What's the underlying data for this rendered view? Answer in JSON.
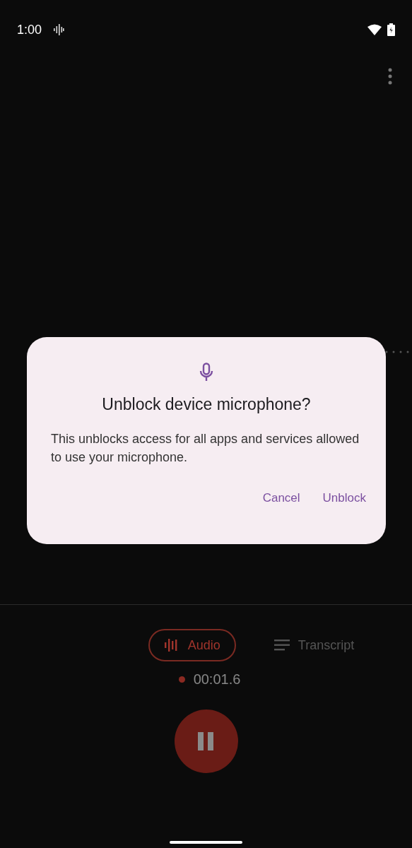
{
  "status_bar": {
    "time": "1:00"
  },
  "dialog": {
    "title": "Unblock device microphone?",
    "message": "This unblocks access for all apps and services allowed to use your microphone.",
    "buttons": [
      "Cancel",
      "Unblock"
    ]
  },
  "tabs": [
    {
      "label": "Audio",
      "kind": "audio",
      "selected": true
    },
    {
      "label": "Transcript",
      "kind": "transcript",
      "selected": false
    }
  ],
  "timer": "00:01.6"
}
